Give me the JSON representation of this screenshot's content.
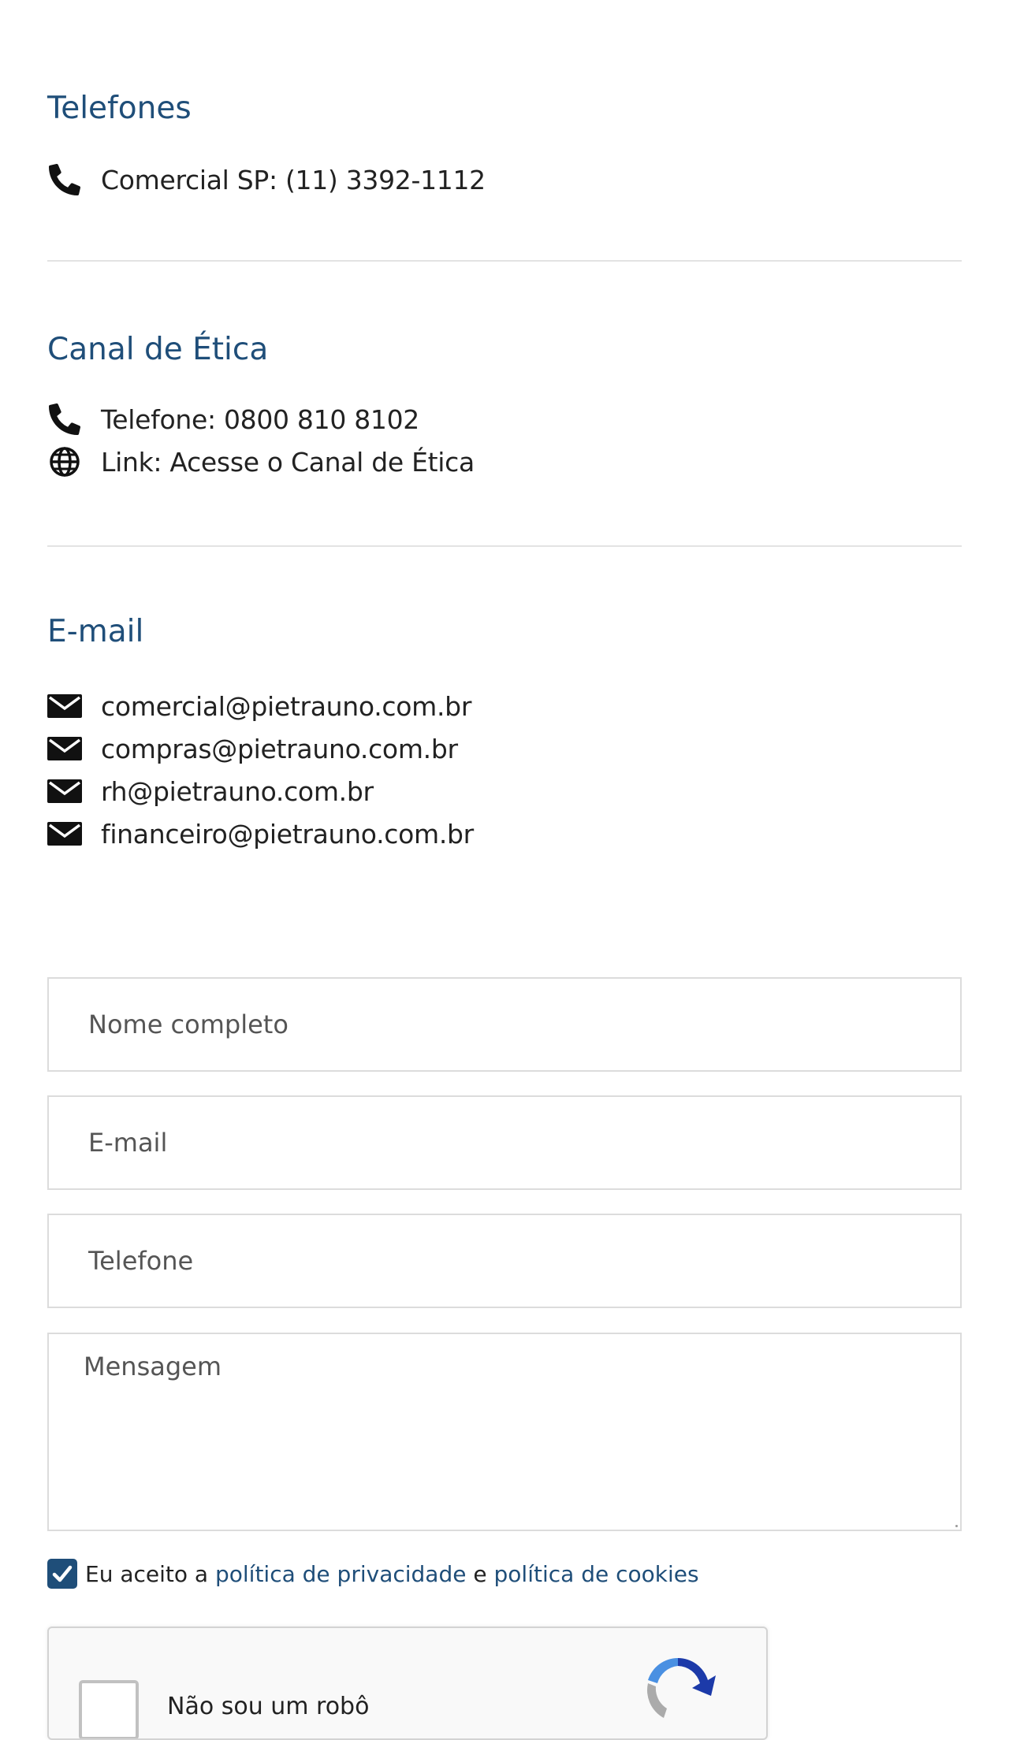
{
  "contact": {
    "phones": {
      "title": "Telefones",
      "items": [
        {
          "icon": "phone-icon",
          "text": "Comercial SP: (11) 3392-1112"
        }
      ]
    },
    "ethics": {
      "title": "Canal de Ética",
      "items": [
        {
          "icon": "phone-icon",
          "text": "Telefone: 0800 810 8102"
        },
        {
          "icon": "globe-icon",
          "text": "Link: Acesse o Canal de Ética"
        }
      ]
    },
    "email": {
      "title": "E-mail",
      "items": [
        {
          "icon": "envelope-icon",
          "text": "comercial@pietrauno.com.br"
        },
        {
          "icon": "envelope-icon",
          "text": "compras@pietrauno.com.br"
        },
        {
          "icon": "envelope-icon",
          "text": "rh@pietrauno.com.br"
        },
        {
          "icon": "envelope-icon",
          "text": "financeiro@pietrauno.com.br"
        }
      ]
    }
  },
  "form": {
    "name_placeholder": "Nome completo",
    "email_placeholder": "E-mail",
    "phone_placeholder": "Telefone",
    "message_placeholder": "Mensagem",
    "name_value": "",
    "email_value": "",
    "phone_value": "",
    "message_value": ""
  },
  "consent": {
    "checked": true,
    "prefix": "Eu aceito a",
    "privacy_link": "política de privacidade",
    "conjunction": "e",
    "cookies_link": "política de cookies"
  },
  "recaptcha": {
    "label": "Não sou um robô",
    "checked": false
  },
  "colors": {
    "heading": "#1f4e79",
    "text": "#222222",
    "border": "#dcdcdc"
  }
}
